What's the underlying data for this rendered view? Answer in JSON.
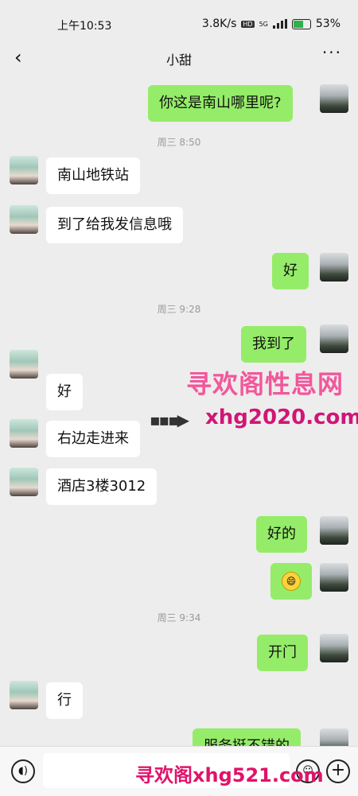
{
  "status_bar": {
    "time": "上午10:53",
    "speed": "3.8K/s",
    "hd": "HD",
    "net": "5G",
    "battery": "53%"
  },
  "header": {
    "title": "小甜",
    "back_icon": "‹",
    "more_icon": "···"
  },
  "messages": [
    {
      "from": "me",
      "text": "你这是南山哪里呢?"
    },
    {
      "timestamp": "周三 8:50"
    },
    {
      "from": "her",
      "text": "南山地铁站"
    },
    {
      "from": "her",
      "text": "到了给我发信息哦"
    },
    {
      "from": "me",
      "text": "好"
    },
    {
      "timestamp": "周三 9:28"
    },
    {
      "from": "me",
      "text": "我到了"
    },
    {
      "from": "her",
      "text": "好"
    },
    {
      "from": "her",
      "text": "右边走进来"
    },
    {
      "from": "her",
      "text": "酒店3楼3012"
    },
    {
      "from": "me",
      "text": "好的"
    },
    {
      "from": "me",
      "emoji": "grinning-face"
    },
    {
      "timestamp": "周三 9:34"
    },
    {
      "from": "me",
      "text": "开门"
    },
    {
      "from": "her",
      "text": "行"
    },
    {
      "from": "me",
      "text": "服务挺不错的"
    }
  ],
  "watermarks": {
    "top_text": "寻欢阁性息网",
    "mid_text": "xhg2020.com",
    "arrow": "▪▪▪▶",
    "bottom_text": "寻欢阁xhg521.com"
  },
  "composer": {
    "voice_icon": "voice-icon",
    "emoji_icon": "emoji-icon",
    "plus_icon": "plus-icon"
  },
  "colors": {
    "my_bubble": "#95ec69",
    "her_bubble": "#ffffff",
    "background": "#ededed"
  }
}
